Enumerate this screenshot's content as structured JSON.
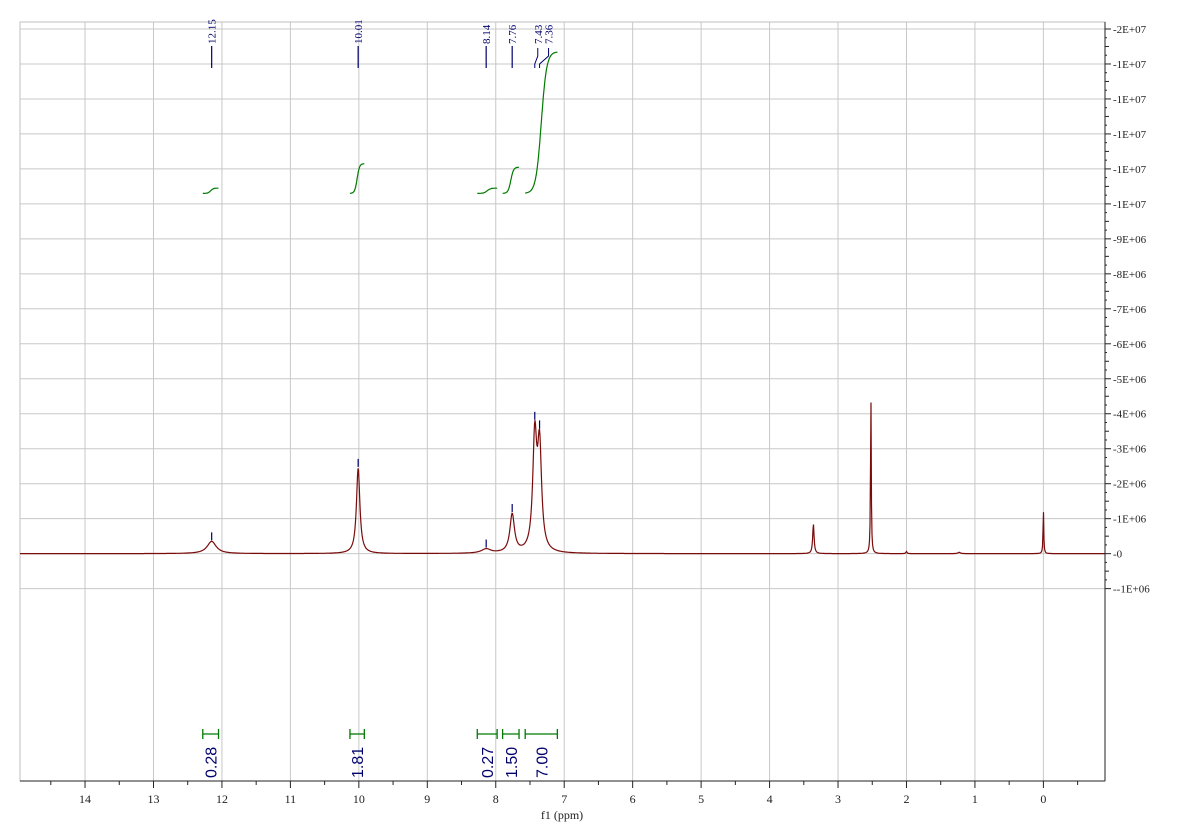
{
  "chart_data": {
    "type": "line",
    "xlabel": "f1 (ppm)",
    "x_reversed": true,
    "xlim": [
      14.95,
      -0.9
    ],
    "ylim": [
      -1500000,
      20200000
    ],
    "x_ticks": [
      "14",
      "13",
      "12",
      "11",
      "10",
      "9",
      "8",
      "7",
      "6",
      "5",
      "4",
      "3",
      "2",
      "1",
      "0"
    ],
    "y_ticks": [
      {
        "v": 20000000,
        "label": "2E+07"
      },
      {
        "v": 19000000,
        "label": "1E+07"
      },
      {
        "v": 18000000,
        "label": "1E+07"
      },
      {
        "v": 17000000,
        "label": "1E+07"
      },
      {
        "v": 16000000,
        "label": "1E+07"
      },
      {
        "v": 15000000,
        "label": "1E+07"
      },
      {
        "v": 14000000,
        "label": "9E+06"
      },
      {
        "v": 13000000,
        "label": "8E+06"
      },
      {
        "v": 12000000,
        "label": "7E+06"
      },
      {
        "v": 11000000,
        "label": "6E+06"
      },
      {
        "v": 10000000,
        "label": "5E+06"
      },
      {
        "v": 9000000,
        "label": "4E+06"
      },
      {
        "v": 8000000,
        "label": "3E+06"
      },
      {
        "v": 7000000,
        "label": "2E+06"
      },
      {
        "v": 6000000,
        "label": "1E+06"
      },
      {
        "v": 5000000,
        "label": "0"
      },
      {
        "v": 4000000,
        "label": "-1E+06"
      }
    ],
    "baseline": 5000000,
    "grid": true,
    "peaks": [
      {
        "ppm": 12.15,
        "height": 350000,
        "width": 0.08
      },
      {
        "ppm": 10.01,
        "height": 2450000,
        "width": 0.03
      },
      {
        "ppm": 8.14,
        "height": 120000,
        "width": 0.08
      },
      {
        "ppm": 7.76,
        "height": 1100000,
        "width": 0.04
      },
      {
        "ppm": 7.43,
        "height": 3200000,
        "width": 0.035
      },
      {
        "ppm": 7.36,
        "height": 2900000,
        "width": 0.035
      },
      {
        "ppm": 3.36,
        "height": 850000,
        "width": 0.012
      },
      {
        "ppm": 2.52,
        "height": 4650000,
        "width": 0.006
      },
      {
        "ppm": 2.0,
        "height": 60000,
        "width": 0.01
      },
      {
        "ppm": 1.23,
        "height": 40000,
        "width": 0.02
      },
      {
        "ppm": 0.0,
        "height": 1270000,
        "width": 0.006
      }
    ],
    "peak_labels": [
      {
        "ppm": 12.15,
        "label": "12.15"
      },
      {
        "ppm": 10.01,
        "label": "10.01"
      },
      {
        "ppm": 8.14,
        "label": "8.14"
      },
      {
        "ppm": 7.76,
        "label": "7.76"
      },
      {
        "ppm": 7.43,
        "label": "7.43"
      },
      {
        "ppm": 7.36,
        "label": "7.36"
      }
    ],
    "integrals": [
      {
        "from": 12.28,
        "to": 12.05,
        "label": "0.28",
        "y_start": 15300000,
        "y_end": 15450000
      },
      {
        "from": 10.13,
        "to": 9.92,
        "label": "1.81",
        "y_start": 15300000,
        "y_end": 16150000
      },
      {
        "from": 8.27,
        "to": 7.98,
        "label": "0.27",
        "y_start": 15300000,
        "y_end": 15450000
      },
      {
        "from": 7.9,
        "to": 7.66,
        "label": "1.50",
        "y_start": 15300000,
        "y_end": 16050000
      },
      {
        "from": 7.57,
        "to": 7.1,
        "label": "7.00",
        "y_start": 15300000,
        "y_end": 19350000
      }
    ]
  },
  "colors": {
    "spectrum": "#7a0b0b",
    "integral": "#007a00",
    "peak_label": "#00006e",
    "integral_label": "#00006e",
    "grid": "#c8c8c8",
    "axis": "#222222"
  }
}
